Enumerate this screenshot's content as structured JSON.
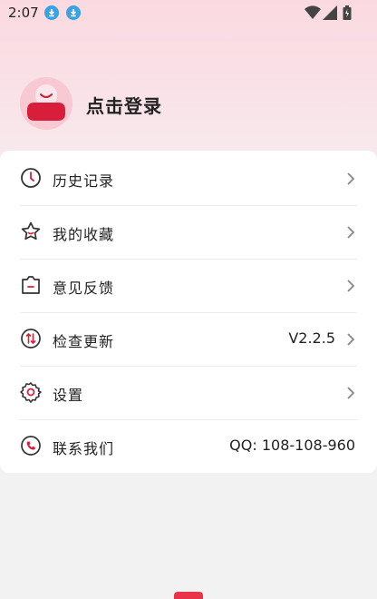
{
  "status_bar": {
    "time": "2:07",
    "icons": [
      "download-icon",
      "download-icon",
      "wifi-icon",
      "signal-icon",
      "battery-icon"
    ]
  },
  "profile": {
    "login_label": "点击登录",
    "avatar_icon": "avatar-icon"
  },
  "menu": {
    "items": [
      {
        "label": "历史记录",
        "icon": "clock-icon",
        "value": "",
        "arrow": true
      },
      {
        "label": "我的收藏",
        "icon": "star-icon",
        "value": "",
        "arrow": true
      },
      {
        "label": "意见反馈",
        "icon": "feedback-icon",
        "value": "",
        "arrow": true
      },
      {
        "label": "检查更新",
        "icon": "update-icon",
        "value": "V2.2.5",
        "arrow": true
      },
      {
        "label": "设置",
        "icon": "gear-icon",
        "value": "",
        "arrow": true
      },
      {
        "label": "联系我们",
        "icon": "phone-icon",
        "value": "QQ: 108-108-960",
        "arrow": false
      }
    ]
  },
  "colors": {
    "accent": "#d81e3a",
    "header_pink": "#fbd9e1",
    "avatar_bg": "#f9c9d3",
    "download_badge": "#3aa1e3"
  }
}
